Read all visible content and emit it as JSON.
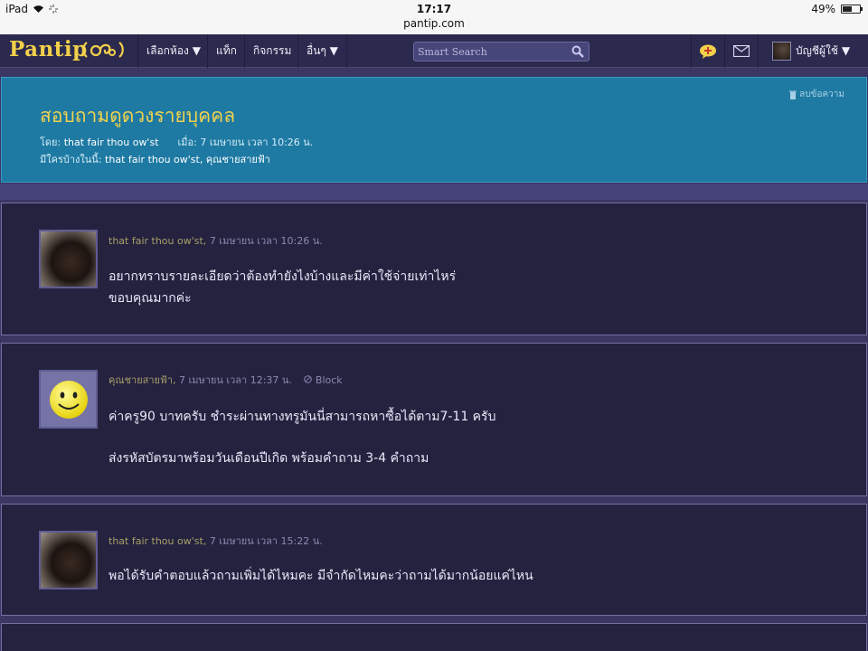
{
  "status_bar": {
    "device": "iPad",
    "time": "17:17",
    "url": "pantip.com",
    "battery": "49%",
    "battery_level": 0.49
  },
  "navbar": {
    "logo": "Pantip",
    "logo_mark": "(ขด)",
    "menu": [
      "เลือกห้อง ▼",
      "แท็ก",
      "กิจกรรม",
      "อื่นๆ ▼"
    ],
    "search_placeholder": "Smart Search",
    "icons": [
      "new-topic-icon",
      "mail-icon"
    ],
    "account_label": "บัญชีผู้ใช้ ▼"
  },
  "topic": {
    "title": "สอบถามดูดวงรายบุคคล",
    "by_label": "โดย:",
    "author": "that fair thou ow'st",
    "when_label": "เมื่อ:",
    "when": "7 เมษายน เวลา 10:26 น.",
    "participants_label": "มีใครบ้างในนี้:",
    "participant_1": "that fair thou ow'st,",
    "participant_2": "คุณชายสายฟ้า",
    "delete_label": "ลบข้อความ"
  },
  "comments": [
    {
      "author": "that fair thou ow'st,",
      "time": "7 เมษายน เวลา 10:26 น.",
      "avatar": "dog-photo",
      "lines": [
        "อยากทราบรายละเอียดว่าต้องทำยังไงบ้างและมีค่าใช้จ่ายเท่าไหร่",
        "ขอบคุณมากค่ะ"
      ]
    },
    {
      "author": "คุณชายสายฟ้า,",
      "time": "7 เมษายน เวลา 12:37 น.",
      "block": "Block",
      "avatar": "smiley",
      "lines": [
        "ค่าครู90 บาทครับ ชำระผ่านทางทรูมันนี่สามารถหาซื้อได้ตาม7-11 ครับ",
        "ส่งรหัสบัตรมาพร้อมวันเดือนปีเกิด พร้อมคำถาม 3-4 คำถาม"
      ]
    },
    {
      "author": "that fair thou ow'st,",
      "time": "7 เมษายน เวลา 15:22 น.",
      "avatar": "dog-photo",
      "lines": [
        "พอได้รับคำตอบแล้วถามเพิ่มได้ไหมคะ มีจำกัดไหมคะว่าถามได้มากน้อยแค่ไหน"
      ]
    }
  ],
  "colors": {
    "background": "#3a3763",
    "header_blue": "#1e7aa3",
    "title_yellow": "#f1d24d",
    "card_bg": "#24223f",
    "author_gold": "#a89f68"
  }
}
